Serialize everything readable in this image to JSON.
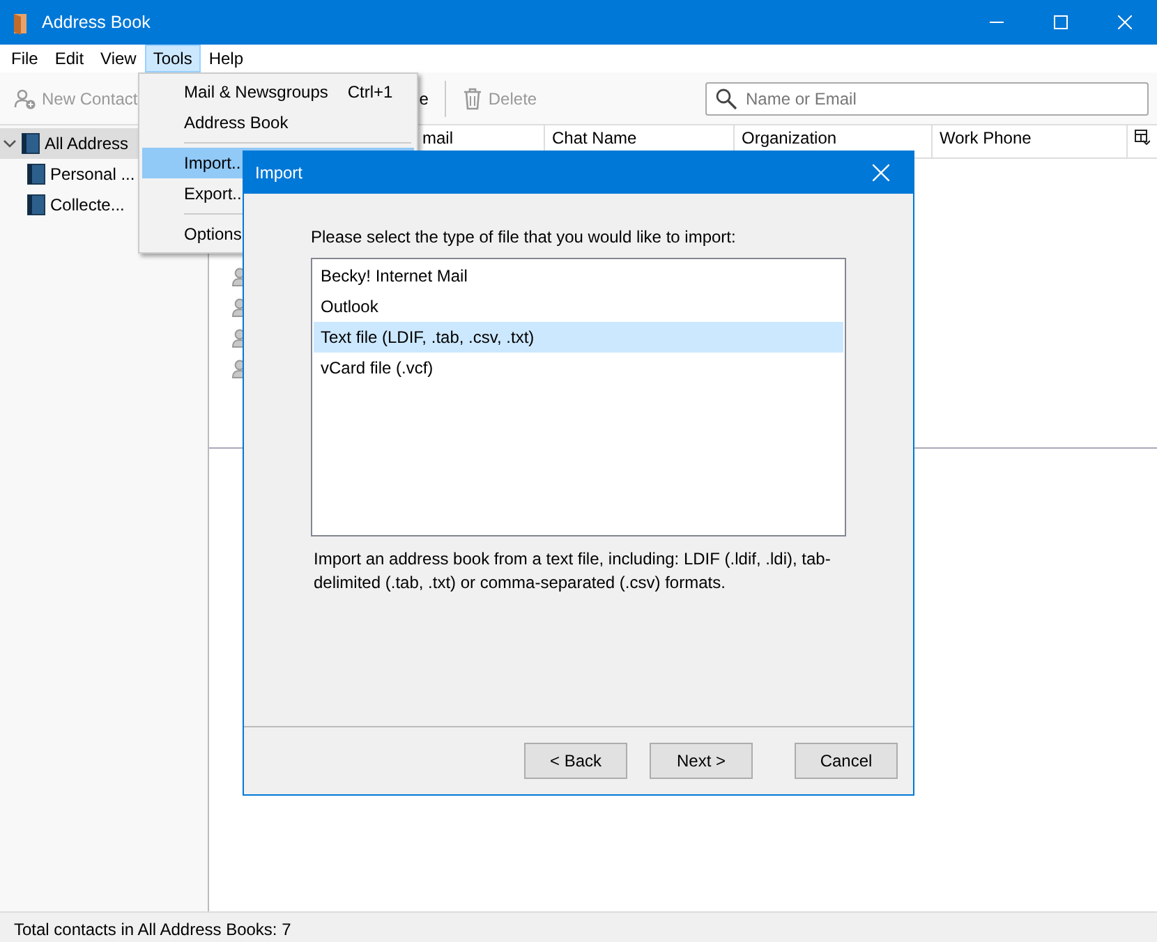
{
  "window": {
    "title": "Address Book"
  },
  "menu_bar": [
    {
      "label": "File",
      "selected": false
    },
    {
      "label": "Edit",
      "selected": false
    },
    {
      "label": "View",
      "selected": false
    },
    {
      "label": "Tools",
      "selected": true
    },
    {
      "label": "Help",
      "selected": false
    }
  ],
  "toolbar": {
    "buttons": [
      {
        "kind": "new-contact",
        "label": "New Contact",
        "disabled": true
      },
      {
        "kind": "plain",
        "label": "e",
        "disabled": false
      },
      {
        "kind": "delete",
        "label": "Delete",
        "disabled": true
      }
    ],
    "search": {
      "placeholder": "Name or Email"
    }
  },
  "sidebar": {
    "items": [
      {
        "label": "All Address",
        "selected": true,
        "expanded": true,
        "children": [
          {
            "label": "Personal ...",
            "selected": false
          },
          {
            "label": "Collecte...",
            "selected": false
          }
        ]
      }
    ]
  },
  "table": {
    "columns": [
      "mail",
      "Chat Name",
      "Organization",
      "Work Phone"
    ],
    "rows": [
      {
        "kind": "contact"
      },
      {
        "kind": "contact"
      },
      {
        "kind": "contact"
      },
      {
        "kind": "contact"
      }
    ]
  },
  "status_bar": "Total contacts in All Address Books: 7",
  "tools_menu": {
    "items": [
      {
        "kind": "item",
        "label": "Mail & Newsgroups",
        "shortcut": "Ctrl+1",
        "selected": false
      },
      {
        "kind": "item",
        "label": "Address Book",
        "selected": false
      },
      {
        "kind": "separator"
      },
      {
        "kind": "item",
        "label": "Import..",
        "selected": true
      },
      {
        "kind": "item",
        "label": "Export..",
        "selected": false
      },
      {
        "kind": "separator"
      },
      {
        "kind": "item",
        "label": "Options",
        "selected": false
      }
    ]
  },
  "dialog": {
    "title": "Import",
    "prompt": "Please select the type of file that you would like to import:",
    "options": [
      {
        "label": "Becky! Internet Mail",
        "selected": false
      },
      {
        "label": "Outlook",
        "selected": false
      },
      {
        "label": "Text file (LDIF, .tab, .csv, .txt)",
        "selected": true
      },
      {
        "label": "vCard file (.vcf)",
        "selected": false
      }
    ],
    "description": "Import an address book from a text file, including: LDIF (.ldif, .ldi), tab-delimited (.tab, .txt) or comma-separated (.csv) formats.",
    "buttons": [
      "< Back",
      "Next >",
      "Cancel"
    ]
  }
}
